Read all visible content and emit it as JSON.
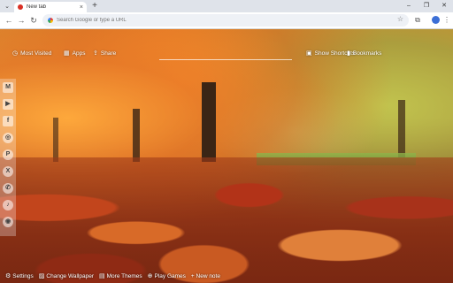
{
  "browser": {
    "tab": {
      "title": "New tab",
      "close": "×"
    },
    "new_tab": "+",
    "window_controls": {
      "minimize": "–",
      "restore": "❐",
      "close": "✕"
    },
    "toolbar": {
      "back": "←",
      "forward": "→",
      "reload": "↻",
      "omnibox_placeholder": "Search Google or type a URL",
      "star": "☆",
      "extensions": "⧉",
      "profile": "●",
      "menu": "⋮"
    },
    "tab_list": "⌄"
  },
  "top_links": {
    "most_visited": "Most Visited",
    "apps": "Apps",
    "share": "Share",
    "show_shortcuts": "Show Shortcuts",
    "bookmarks": "Bookmarks"
  },
  "social": [
    {
      "name": "gmail-icon",
      "glyph": "M"
    },
    {
      "name": "youtube-icon",
      "glyph": "▶"
    },
    {
      "name": "facebook-icon",
      "glyph": "f"
    },
    {
      "name": "instagram-icon",
      "glyph": "◎"
    },
    {
      "name": "pinterest-icon",
      "glyph": "P"
    },
    {
      "name": "x-icon",
      "glyph": "X"
    },
    {
      "name": "whatsapp-icon",
      "glyph": "✆"
    },
    {
      "name": "tiktok-icon",
      "glyph": "♪"
    },
    {
      "name": "reddit-icon",
      "glyph": "◉"
    }
  ],
  "bottom_bar": {
    "settings": "Settings",
    "change_wallpaper": "Change Wallpaper",
    "more_themes": "More Themes",
    "play_games": "Play Games",
    "new_note": "+ New note"
  }
}
